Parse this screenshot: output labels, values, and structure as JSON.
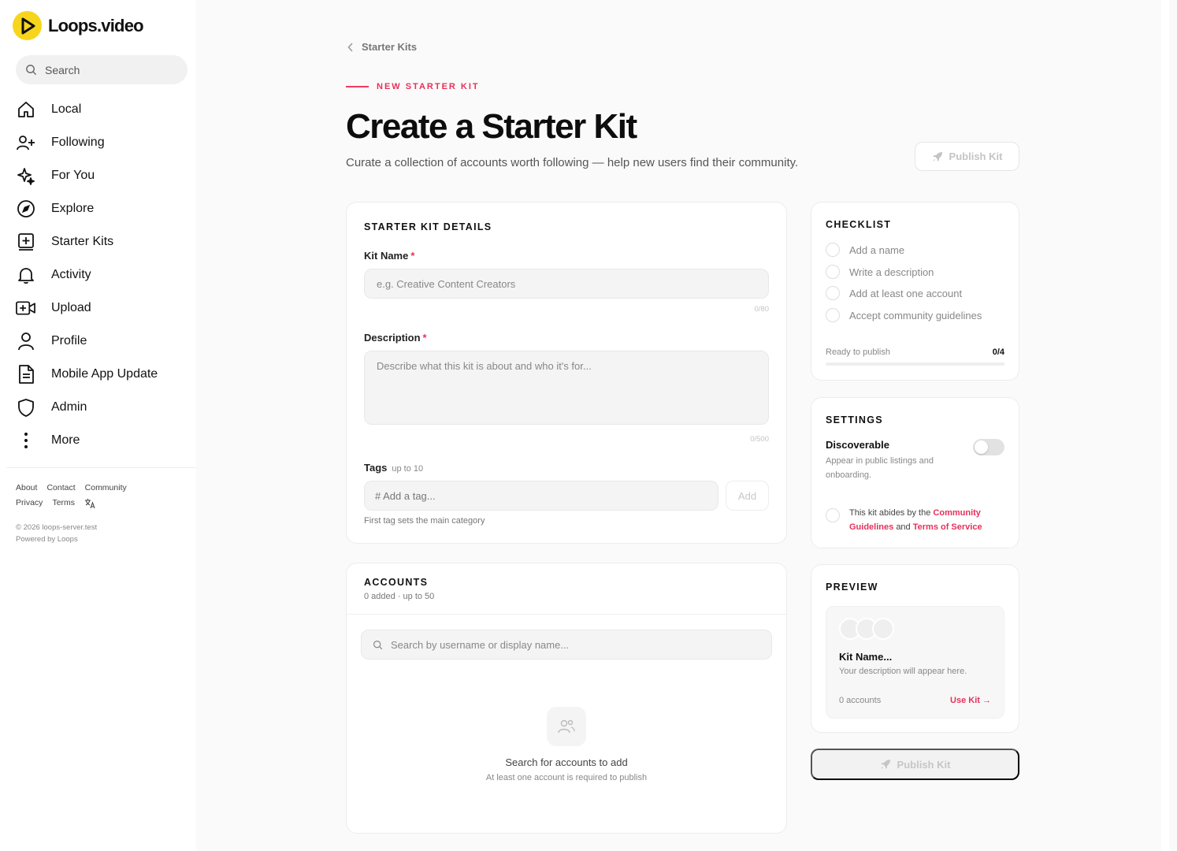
{
  "app": {
    "name": "Loops.video"
  },
  "sidebar": {
    "search_placeholder": "Search",
    "items": [
      {
        "label": "Local",
        "icon": "home-icon"
      },
      {
        "label": "Following",
        "icon": "user-plus-icon"
      },
      {
        "label": "For You",
        "icon": "sparkles-icon"
      },
      {
        "label": "Explore",
        "icon": "compass-icon"
      },
      {
        "label": "Starter Kits",
        "icon": "plus-square-icon"
      },
      {
        "label": "Activity",
        "icon": "bell-icon"
      },
      {
        "label": "Upload",
        "icon": "video-plus-icon"
      },
      {
        "label": "Profile",
        "icon": "user-icon"
      },
      {
        "label": "Mobile App Update",
        "icon": "document-icon"
      },
      {
        "label": "Admin",
        "icon": "shield-icon"
      },
      {
        "label": "More",
        "icon": "more-vertical-icon"
      }
    ],
    "footer": {
      "about": "About",
      "contact": "Contact",
      "community": "Community",
      "privacy": "Privacy",
      "terms": "Terms",
      "copyright": "© 2026 loops-server.test",
      "powered": "Powered by Loops"
    }
  },
  "header": {
    "breadcrumb": "Starter Kits",
    "eyebrow": "NEW STARTER KIT",
    "title": "Create a Starter Kit",
    "subtitle": "Curate a collection of accounts worth following — help new users find their community.",
    "publish_label": "Publish Kit"
  },
  "details": {
    "heading": "STARTER KIT DETAILS",
    "name_label": "Kit Name",
    "name_placeholder": "e.g. Creative Content Creators",
    "name_counter": "0/80",
    "desc_label": "Description",
    "desc_placeholder": "Describe what this kit is about and who it's for...",
    "desc_counter": "0/500",
    "required_mark": "*",
    "tags_label": "Tags",
    "tags_limit": "up to 10",
    "tags_placeholder": "# Add a tag...",
    "tags_add": "Add",
    "tags_hint": "First tag sets the main category"
  },
  "accounts": {
    "heading": "ACCOUNTS",
    "sub": "0 added · up to 50",
    "search_placeholder": "Search by username or display name...",
    "empty_title": "Search for accounts to add",
    "empty_sub": "At least one account is required to publish"
  },
  "checklist": {
    "heading": "CHECKLIST",
    "items": [
      "Add a name",
      "Write a description",
      "Add at least one account",
      "Accept community guidelines"
    ],
    "ready_label": "Ready to publish",
    "progress": "0/4",
    "progress_fraction": 0
  },
  "settings": {
    "heading": "SETTINGS",
    "discoverable_label": "Discoverable",
    "discoverable_desc": "Appear in public listings and onboarding.",
    "discoverable_on": false,
    "agree_prefix": "This kit abides by the",
    "agree_link1": "Community Guidelines",
    "agree_and": "and",
    "agree_link2": "Terms of Service"
  },
  "preview": {
    "heading": "PREVIEW",
    "name": "Kit Name...",
    "desc": "Your description will appear here.",
    "accounts": "0 accounts",
    "use_kit": "Use Kit →"
  },
  "colors": {
    "accent": "#e8305a",
    "brand_yellow": "#f7d51d"
  }
}
